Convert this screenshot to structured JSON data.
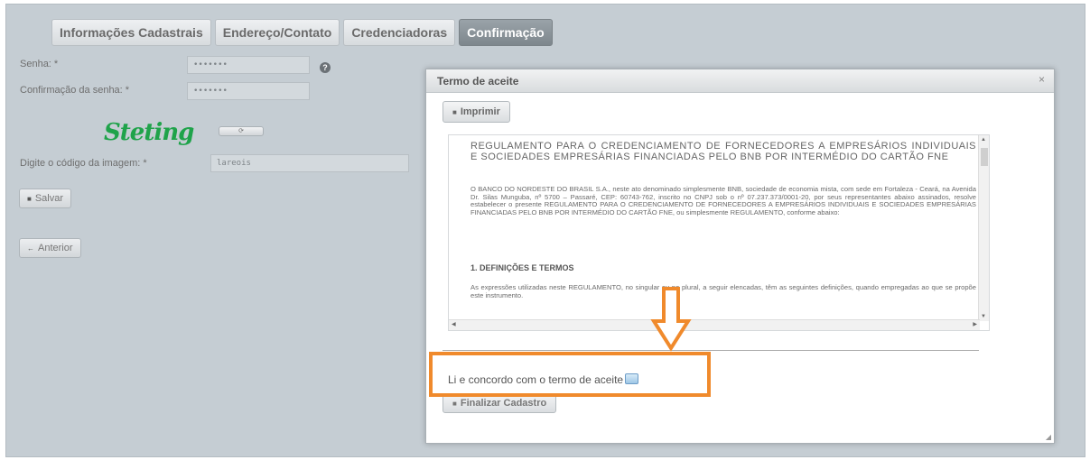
{
  "tabs": [
    {
      "label": "Informações Cadastrais",
      "active": false
    },
    {
      "label": "Endereço/Contato",
      "active": false
    },
    {
      "label": "Credenciadoras",
      "active": false
    },
    {
      "label": "Confirmação",
      "active": true
    }
  ],
  "form": {
    "password_label": "Senha: *",
    "password_value": "•••••••",
    "confirm_label": "Confirmação da senha: *",
    "confirm_value": "•••••••",
    "captcha_text": "Steting",
    "captcha_code_label": "Digite o código da imagem: *",
    "captcha_code_value": "lareois",
    "save_label": "Salvar",
    "back_label": "Anterior"
  },
  "dialog": {
    "title": "Termo de aceite",
    "close_glyph": "×",
    "print_label": "Imprimir",
    "doc_title": "REGULAMENTO PARA O CREDENCIAMENTO DE FORNECEDORES A EMPRESÁRIOS INDIVIDUAIS E SOCIEDADES EMPRESÁRIAS FINANCIADAS PELO BNB POR INTERMÉDIO DO CARTÃO FNE",
    "doc_paragraph": "O BANCO DO NORDESTE DO BRASIL S.A., neste ato denominado simplesmente BNB, sociedade de economia mista, com sede em Fortaleza - Ceará, na Avenida Dr. Silas Munguba, nº 5700 – Passaré, CEP: 60743-762, inscrito no CNPJ sob o nº 07.237.373/0001-20, por seus representantes abaixo assinados, resolve estabelecer o presente REGULAMENTO PARA O CREDENCIAMENTO DE FORNECEDORES A EMPRESÁRIOS INDIVIDUAIS E SOCIEDADES EMPRESÁRIAS FINANCIADAS PELO BNB POR INTERMÉDIO DO CARTÃO FNE, ou simplesmente REGULAMENTO, conforme abaixo:",
    "section_heading": "1.  DEFINIÇÕES E TERMOS",
    "section_paragraph": "As expressões utilizadas neste REGULAMENTO, no singular ou no plural, a seguir elencadas, têm as seguintes definições, quando empregadas ao que se propõe este instrumento.",
    "agree_label": "Li e concordo com o termo de aceite",
    "agree_checked": false,
    "finish_label": "Finalizar Cadastro"
  },
  "colors": {
    "background": "#c5cdd3",
    "active_tab": "#8a9399",
    "highlight": "#f08a2c",
    "captcha": "#1fa34a"
  }
}
